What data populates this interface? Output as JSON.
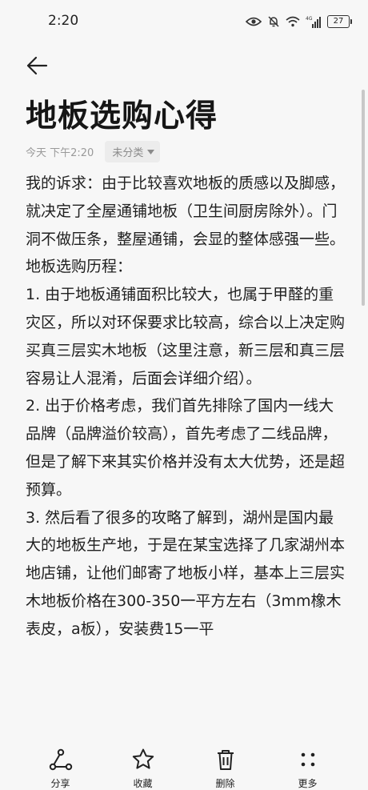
{
  "status_bar": {
    "time": "2:20",
    "network_badge": "4G",
    "battery_level": "27"
  },
  "note": {
    "title": "地板选购心得",
    "date": "今天 下午2:20",
    "category": "未分类",
    "paragraphs": [
      "我的诉求：由于比较喜欢地板的质感以及脚感，就决定了全屋通铺地板（卫生间厨房除外）。门洞不做压条，整屋通铺，会显的整体感强一些。",
      "地板选购历程：",
      "1. 由于地板通铺面积比较大，也属于甲醛的重灾区，所以对环保要求比较高，综合以上决定购买真三层实木地板（这里注意，新三层和真三层容易让人混淆，后面会详细介绍）。",
      "2. 出于价格考虑，我们首先排除了国内一线大品牌（品牌溢价较高），首先考虑了二线品牌，但是了解下来其实价格并没有太大优势，还是超预算。",
      "3. 然后看了很多的攻略了解到，湖州是国内最大的地板生产地，于是在某宝选择了几家湖州本地店铺，让他们邮寄了地板小样，基本上三层实木地板价格在300-350一平方左右（3mm橡木表皮，a板），安装费15一平"
    ]
  },
  "bottom_bar": {
    "share_label": "分享",
    "favorite_label": "收藏",
    "delete_label": "删除",
    "more_label": "更多"
  },
  "colors": {
    "background": "#f7f7f7",
    "text": "#202020",
    "muted": "#9a9a9a",
    "chip": "#ececec"
  }
}
